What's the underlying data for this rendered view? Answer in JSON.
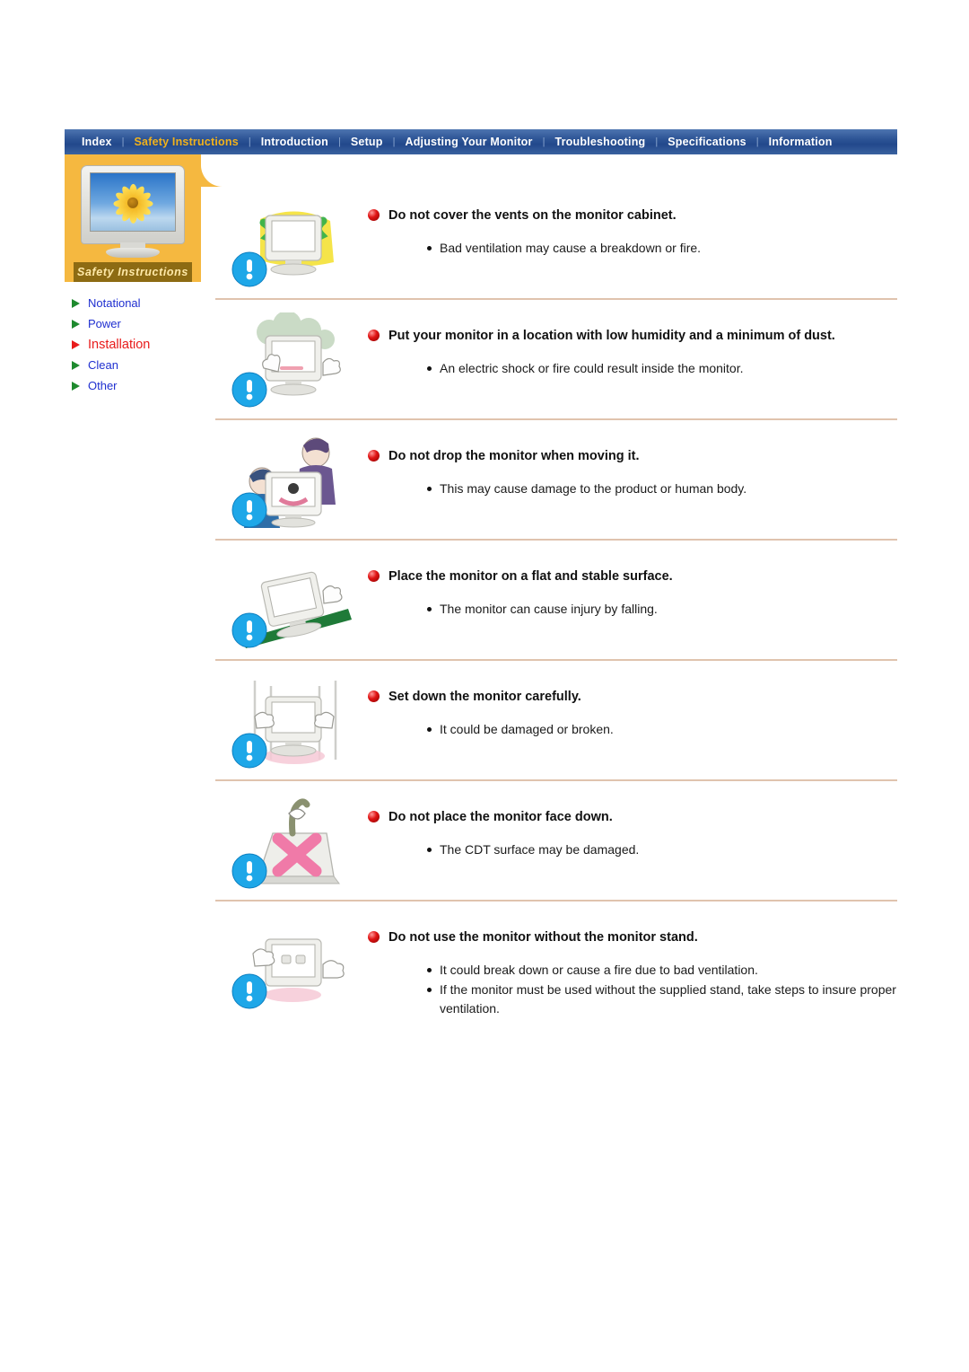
{
  "topnav": {
    "items": [
      {
        "label": "Index",
        "active": false
      },
      {
        "label": "Safety Instructions",
        "active": true
      },
      {
        "label": "Introduction",
        "active": false
      },
      {
        "label": "Setup",
        "active": false
      },
      {
        "label": "Adjusting Your Monitor",
        "active": false
      },
      {
        "label": "Troubleshooting",
        "active": false
      },
      {
        "label": "Specifications",
        "active": false
      },
      {
        "label": "Information",
        "active": false
      }
    ],
    "separator": "|",
    "accent_color": "#f2b21b",
    "bar_color": "#2e5596"
  },
  "sidebar": {
    "card_caption": "Safety Instructions",
    "card_color": "#f5b840",
    "items": [
      {
        "label": "Notational",
        "active": false
      },
      {
        "label": "Power",
        "active": false
      },
      {
        "label": "Installation",
        "active": true
      },
      {
        "label": "Clean",
        "active": false
      },
      {
        "label": "Other",
        "active": false
      }
    ],
    "link_color": "#1f2fd0",
    "active_color": "#e81b1b"
  },
  "sections": [
    {
      "icon": "monitor-covered-with-cloth-icon",
      "heading": "Do not cover the vents on the monitor cabinet.",
      "notes": [
        "Bad ventilation may cause a breakdown or fire."
      ]
    },
    {
      "icon": "monitor-in-dusty-humid-place-icon",
      "heading": "Put your monitor in a location with low humidity and a minimum of dust.",
      "notes": [
        "An electric shock or fire could result inside the monitor."
      ]
    },
    {
      "icon": "two-people-carrying-monitor-icon",
      "heading": "Do not drop the monitor when moving it.",
      "notes": [
        "This may cause damage to the product or human body."
      ]
    },
    {
      "icon": "monitor-on-sloped-surface-icon",
      "heading": "Place the monitor on a flat and stable surface.",
      "notes": [
        "The monitor can cause injury by falling."
      ]
    },
    {
      "icon": "hands-setting-monitor-down-icon",
      "heading": "Set down the monitor carefully.",
      "notes": [
        "It could be damaged or broken."
      ]
    },
    {
      "icon": "monitor-face-down-crossed-icon",
      "heading": "Do not place the monitor face down.",
      "notes": [
        "The CDT surface may be damaged."
      ]
    },
    {
      "icon": "monitor-without-stand-icon",
      "heading": "Do not use the monitor without the monitor stand.",
      "notes": [
        "It could break down or cause a fire due to bad ventilation.",
        "If the monitor must be used without the supplied stand, take steps to insure proper ventilation."
      ]
    }
  ]
}
